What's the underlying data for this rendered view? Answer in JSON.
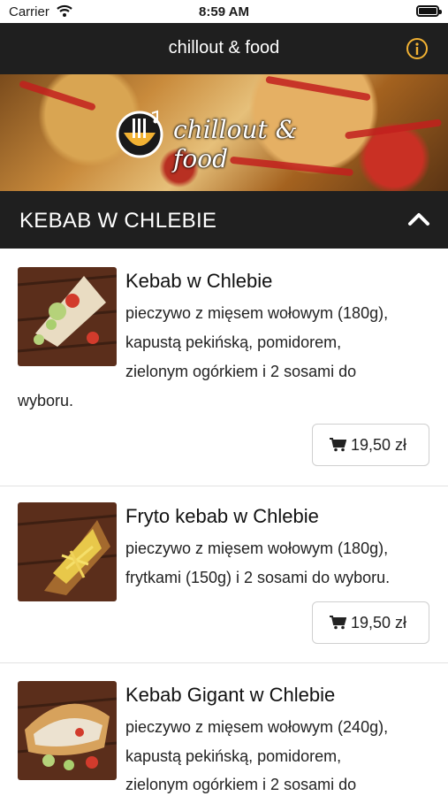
{
  "status_bar": {
    "carrier": "Carrier",
    "time": "8:59 AM"
  },
  "nav": {
    "title": "chillout & food"
  },
  "banner": {
    "logo_text": "chillout & food"
  },
  "section": {
    "title": "KEBAB W CHLEBIE"
  },
  "items": [
    {
      "name": "Kebab w Chlebie",
      "desc_lines": [
        "pieczywo z mięsem wołowym (180g),",
        "kapustą pekińską, pomidorem,",
        "zielonym ogórkiem i 2 sosami do",
        "wyboru."
      ],
      "price": "19,50 zł"
    },
    {
      "name": "Fryto kebab w Chlebie",
      "desc_lines": [
        "pieczywo z mięsem wołowym (180g),",
        "frytkami (150g) i 2 sosami do wyboru."
      ],
      "price": "19,50 zł"
    },
    {
      "name": "Kebab Gigant w Chlebie",
      "desc_lines": [
        "pieczywo z mięsem wołowym (240g),",
        "kapustą pekińską, pomidorem,",
        "zielonym ogórkiem i 2 sosami do"
      ]
    }
  ],
  "colors": {
    "nav_bg": "#1f1f1f",
    "accent_info": "#f2b233",
    "divider": "#e2e2e2"
  },
  "icons": {
    "info": "info-circle-icon",
    "chevron": "chevron-up-icon",
    "cart": "cart-icon",
    "wifi": "wifi-icon",
    "battery": "battery-icon"
  }
}
